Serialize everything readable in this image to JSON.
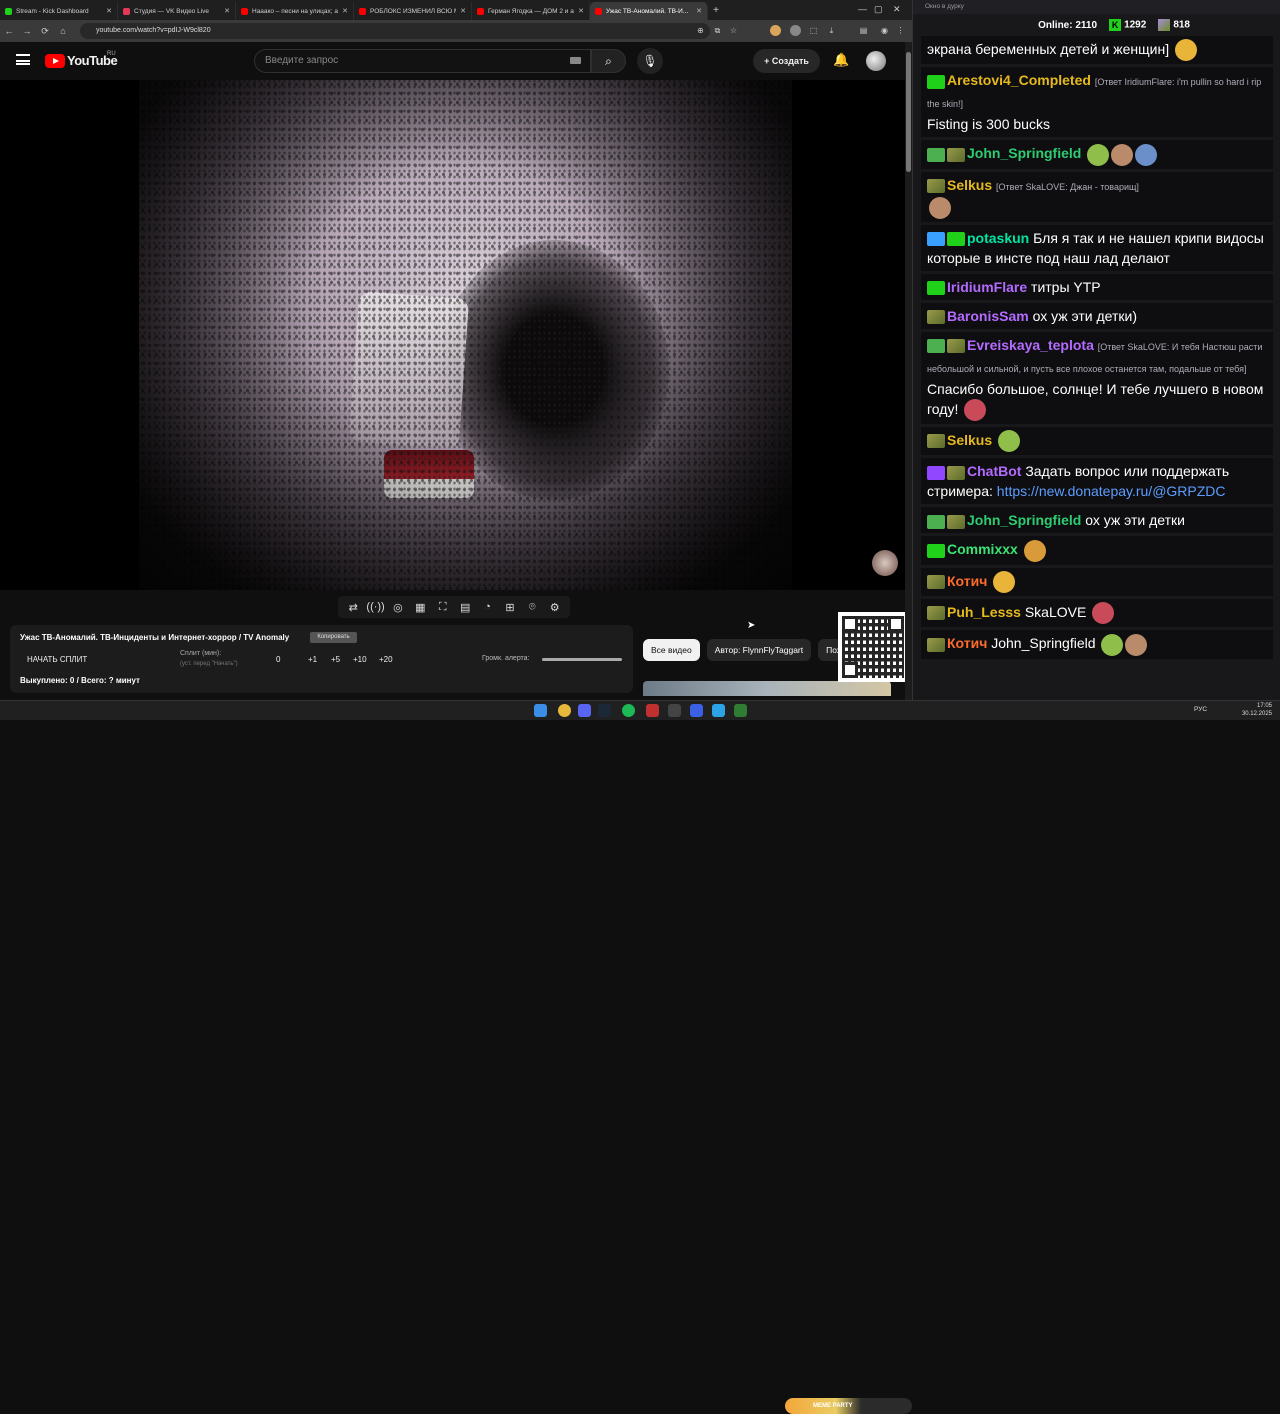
{
  "tabs": [
    {
      "title": "Stream - Kick Dashboard",
      "color": "#1fd219",
      "active": false
    },
    {
      "title": "Студия — VK Видео Live",
      "color": "#e8385a",
      "active": false
    },
    {
      "title": "Нааакo – песни на улицах; арс",
      "color": "#ff0000",
      "active": false
    },
    {
      "title": "РОБЛОКС ИЗМЕНИЛ ВСЮ МОЮ",
      "color": "#ff0000",
      "active": false
    },
    {
      "title": "Герман Ягодка — ДОМ 2 и ани",
      "color": "#ff0000",
      "active": false
    },
    {
      "title": "Ужас ТВ-Аномалий. ТВ-И...",
      "color": "#ff0000",
      "active": true
    }
  ],
  "address": {
    "url": "youtube.com/watch?v=pdIJ-W9cl820"
  },
  "youtube": {
    "logo_text": "YouTube",
    "region": "RU",
    "search_placeholder": "Введите запрос",
    "create_label": "Создать"
  },
  "player_controls": [
    "loop-icon",
    "broadcast-icon",
    "live-icon",
    "clapper-icon",
    "resize-icon",
    "subtitles-icon",
    "speed-icon",
    "add-icon",
    "screenshot-icon",
    "settings-icon"
  ],
  "info_panel": {
    "title": "Ужас ТВ-Аномалий. ТВ-Инциденты и Интернет-хоррор / TV Anomaly",
    "copy_label": "Копировать",
    "start_split": "НАЧАТЬ СПЛИТ",
    "split_label": "Сплит (мин):",
    "split_hint": "(уст. перед \"Начать\")",
    "split_value": "0",
    "increments": [
      "+1",
      "+5",
      "+10",
      "+20"
    ],
    "alert_volume_label": "Громк. алерта:",
    "bought": "Выкуплено: 0 / Всего: ? минут"
  },
  "filter_chips": [
    {
      "label": "Все видео",
      "selected": true
    },
    {
      "label": "Автор: FlynnFlyTaggart",
      "selected": false
    },
    {
      "label": "Пох",
      "selected": false
    }
  ],
  "chat": {
    "window_title": "Окно в дурку",
    "online_label": "Online:",
    "online_count": "2110",
    "kick_count": "1292",
    "twitch_count": "818",
    "messages": [
      {
        "user": "",
        "color": "#ffffff",
        "reply": "",
        "text": "экрана беременных детей и женщин]",
        "badges": [],
        "emotes": 1
      },
      {
        "user": "Arestovi4_Completed",
        "color": "#e6b91e",
        "reply": "[Ответ IridiumFlare: i'm pullin so hard i rip the skin!]",
        "text": "Fisting is 300 bucks",
        "badges": [
          "b-k"
        ],
        "emotes": 0
      },
      {
        "user": "John_Springfield",
        "color": "#2ecc71",
        "reply": "",
        "text": "",
        "badges": [
          "b-check",
          "b-mod"
        ],
        "emotes": 3
      },
      {
        "user": "Selkus",
        "color": "#e6b91e",
        "reply": "[Ответ SkaLOVE: Джан - товарищ]",
        "text": "",
        "badges": [
          "b-mod"
        ],
        "emotes": 1
      },
      {
        "user": "potaskun",
        "color": "#00e5a0",
        "reply": "",
        "text": "Бля я так и не нашел крипи видосы которые в инсте под наш лад делают",
        "badges": [
          "b-sword",
          "b-k"
        ],
        "emotes": 0
      },
      {
        "user": "IridiumFlare",
        "color": "#b36bff",
        "reply": "",
        "text": "титры YTP",
        "badges": [
          "b-k"
        ],
        "emotes": 0
      },
      {
        "user": "BaronisSam",
        "color": "#b36bff",
        "reply": "",
        "text": "ох уж эти детки)",
        "badges": [
          "b-mod"
        ],
        "emotes": 0
      },
      {
        "user": "Evreiskaya_teplota",
        "color": "#b36bff",
        "reply": "[Ответ SkaLOVE: И тебя Настюш расти небольшой и сильной, и пусть все плохое останется там, подальше от тебя]",
        "text": "Спасибо большое, солнце! И тебе лучшего в новом году!",
        "badges": [
          "b-check",
          "b-mod"
        ],
        "emotes": 1
      },
      {
        "user": "Selkus",
        "color": "#e6b91e",
        "reply": "",
        "text": "",
        "badges": [
          "b-mod"
        ],
        "emotes": 1
      },
      {
        "user": "ChatBot",
        "color": "#b36bff",
        "reply": "",
        "text": "Задать вопрос или поддержать стримера:",
        "link": "https://new.donatepay.ru/@GRPZDC",
        "badges": [
          "b-bot",
          "b-mod"
        ],
        "emotes": 0
      },
      {
        "user": "John_Springfield",
        "color": "#2ecc71",
        "reply": "",
        "text": "ох уж эти детки",
        "badges": [
          "b-check",
          "b-mod"
        ],
        "emotes": 0
      },
      {
        "user": "Commixxx",
        "color": "#3ae374",
        "reply": "",
        "text": "",
        "badges": [
          "b-k"
        ],
        "emotes": 1
      },
      {
        "user": "Котич",
        "color": "#ff6b2d",
        "reply": "",
        "text": "",
        "badges": [
          "b-mod"
        ],
        "emotes": 1
      },
      {
        "user": "Puh_Lesss",
        "color": "#e6b91e",
        "reply": "",
        "text": "SkaLOVE",
        "badges": [
          "b-mod"
        ],
        "emotes": 1
      },
      {
        "user": "Котич",
        "color": "#ff6b2d",
        "reply": "",
        "text": "John_Springfield",
        "badges": [
          "b-mod"
        ],
        "emotes": 2
      }
    ]
  },
  "taskbar": {
    "lang": "РУС",
    "time": "17:05",
    "date": "30.12.2025",
    "meme_party": "MEME PARTY"
  }
}
